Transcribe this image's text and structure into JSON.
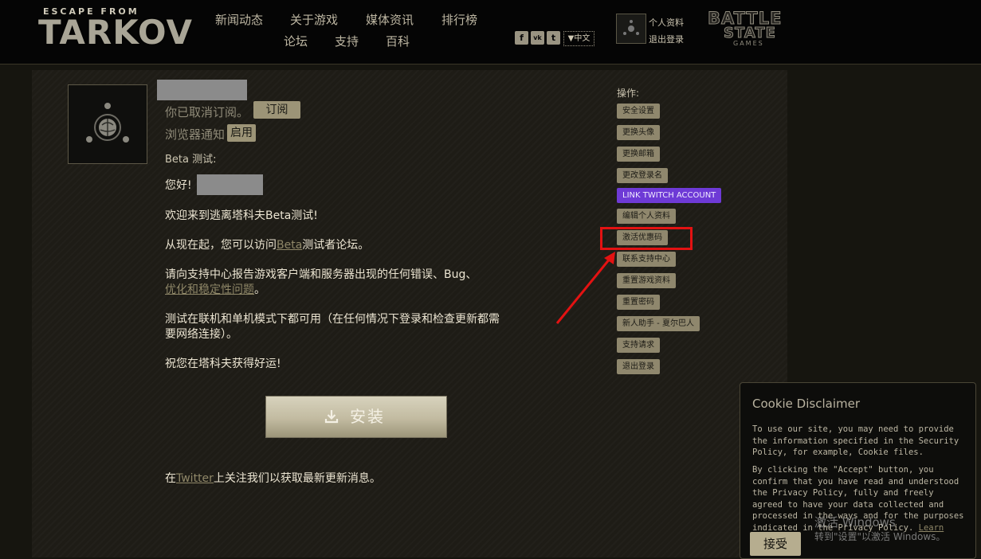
{
  "header": {
    "logo_top": "ESCAPE FROM",
    "logo_main": "TARKOV",
    "nav": [
      "新闻动态",
      "关于游戏",
      "媒体资讯",
      "排行榜",
      "论坛",
      "支持",
      "百科"
    ],
    "social": [
      "f",
      "vk",
      "t"
    ],
    "language": "▼中文",
    "profile_label": "个人资料",
    "logout_label": "退出登录",
    "bsg_line1": "BATTLE",
    "bsg_line2": "STATE",
    "bsg_line3": "GAMES"
  },
  "content": {
    "unsubscribed_text": "你已取消订阅。",
    "subscribe_button": "订阅",
    "browser_notify_text": "浏览器通知",
    "enable_button": "启用",
    "beta_label": "Beta 测试:",
    "greeting": "您好!",
    "welcome": "欢迎来到逃离塔科夫Beta测试!",
    "forum_prefix": "从现在起，您可以访问",
    "forum_link": "Beta",
    "forum_suffix": "测试者论坛。",
    "report_line1": "请向支持中心报告游戏客户端和服务器出现的任何错误、Bug、",
    "report_link": "优化和稳定性问题",
    "report_end": "。",
    "mode_line1": "测试在联机和单机模式下都可用（在任何情况下登录和检查更新都需",
    "mode_line2": "要网络连接）。",
    "good_luck": "祝您在塔科夫获得好运!",
    "install_button": "安装",
    "follow_prefix": "在",
    "follow_link": "Twitter",
    "follow_suffix": "上关注我们以获取最新更新消息。"
  },
  "sidebar": {
    "title": "操作:",
    "items": [
      "安全设置",
      "更换头像",
      "更换邮箱",
      "更改登录名",
      "LINK TWITCH ACCOUNT",
      "编辑个人资料",
      "激活优惠码",
      "联系支持中心",
      "重置游戏资料",
      "重置密码",
      "新人助手 - 夏尔巴人",
      "支持请求",
      "退出登录"
    ]
  },
  "cookie": {
    "title": "Cookie Disclaimer",
    "p1": "To use our site, you may need to provide the information specified in the Security Policy, for example, Cookie files.",
    "p2": "By clicking the \"Accept\" button, you confirm that you have read and understood the Privacy Policy, fully and freely agreed to have your data collected and processed in the ways and for the purposes indicated in the Privacy Policy.",
    "learn_more": "Learn more",
    "accept": "接受"
  },
  "watermark": {
    "line1": "激活 Windows",
    "line2": "转到\"设置\"以激活 Windows。"
  },
  "colors": {
    "accent": "#9c9477",
    "twitch": "#6e3ad6",
    "highlight": "#e31212"
  }
}
